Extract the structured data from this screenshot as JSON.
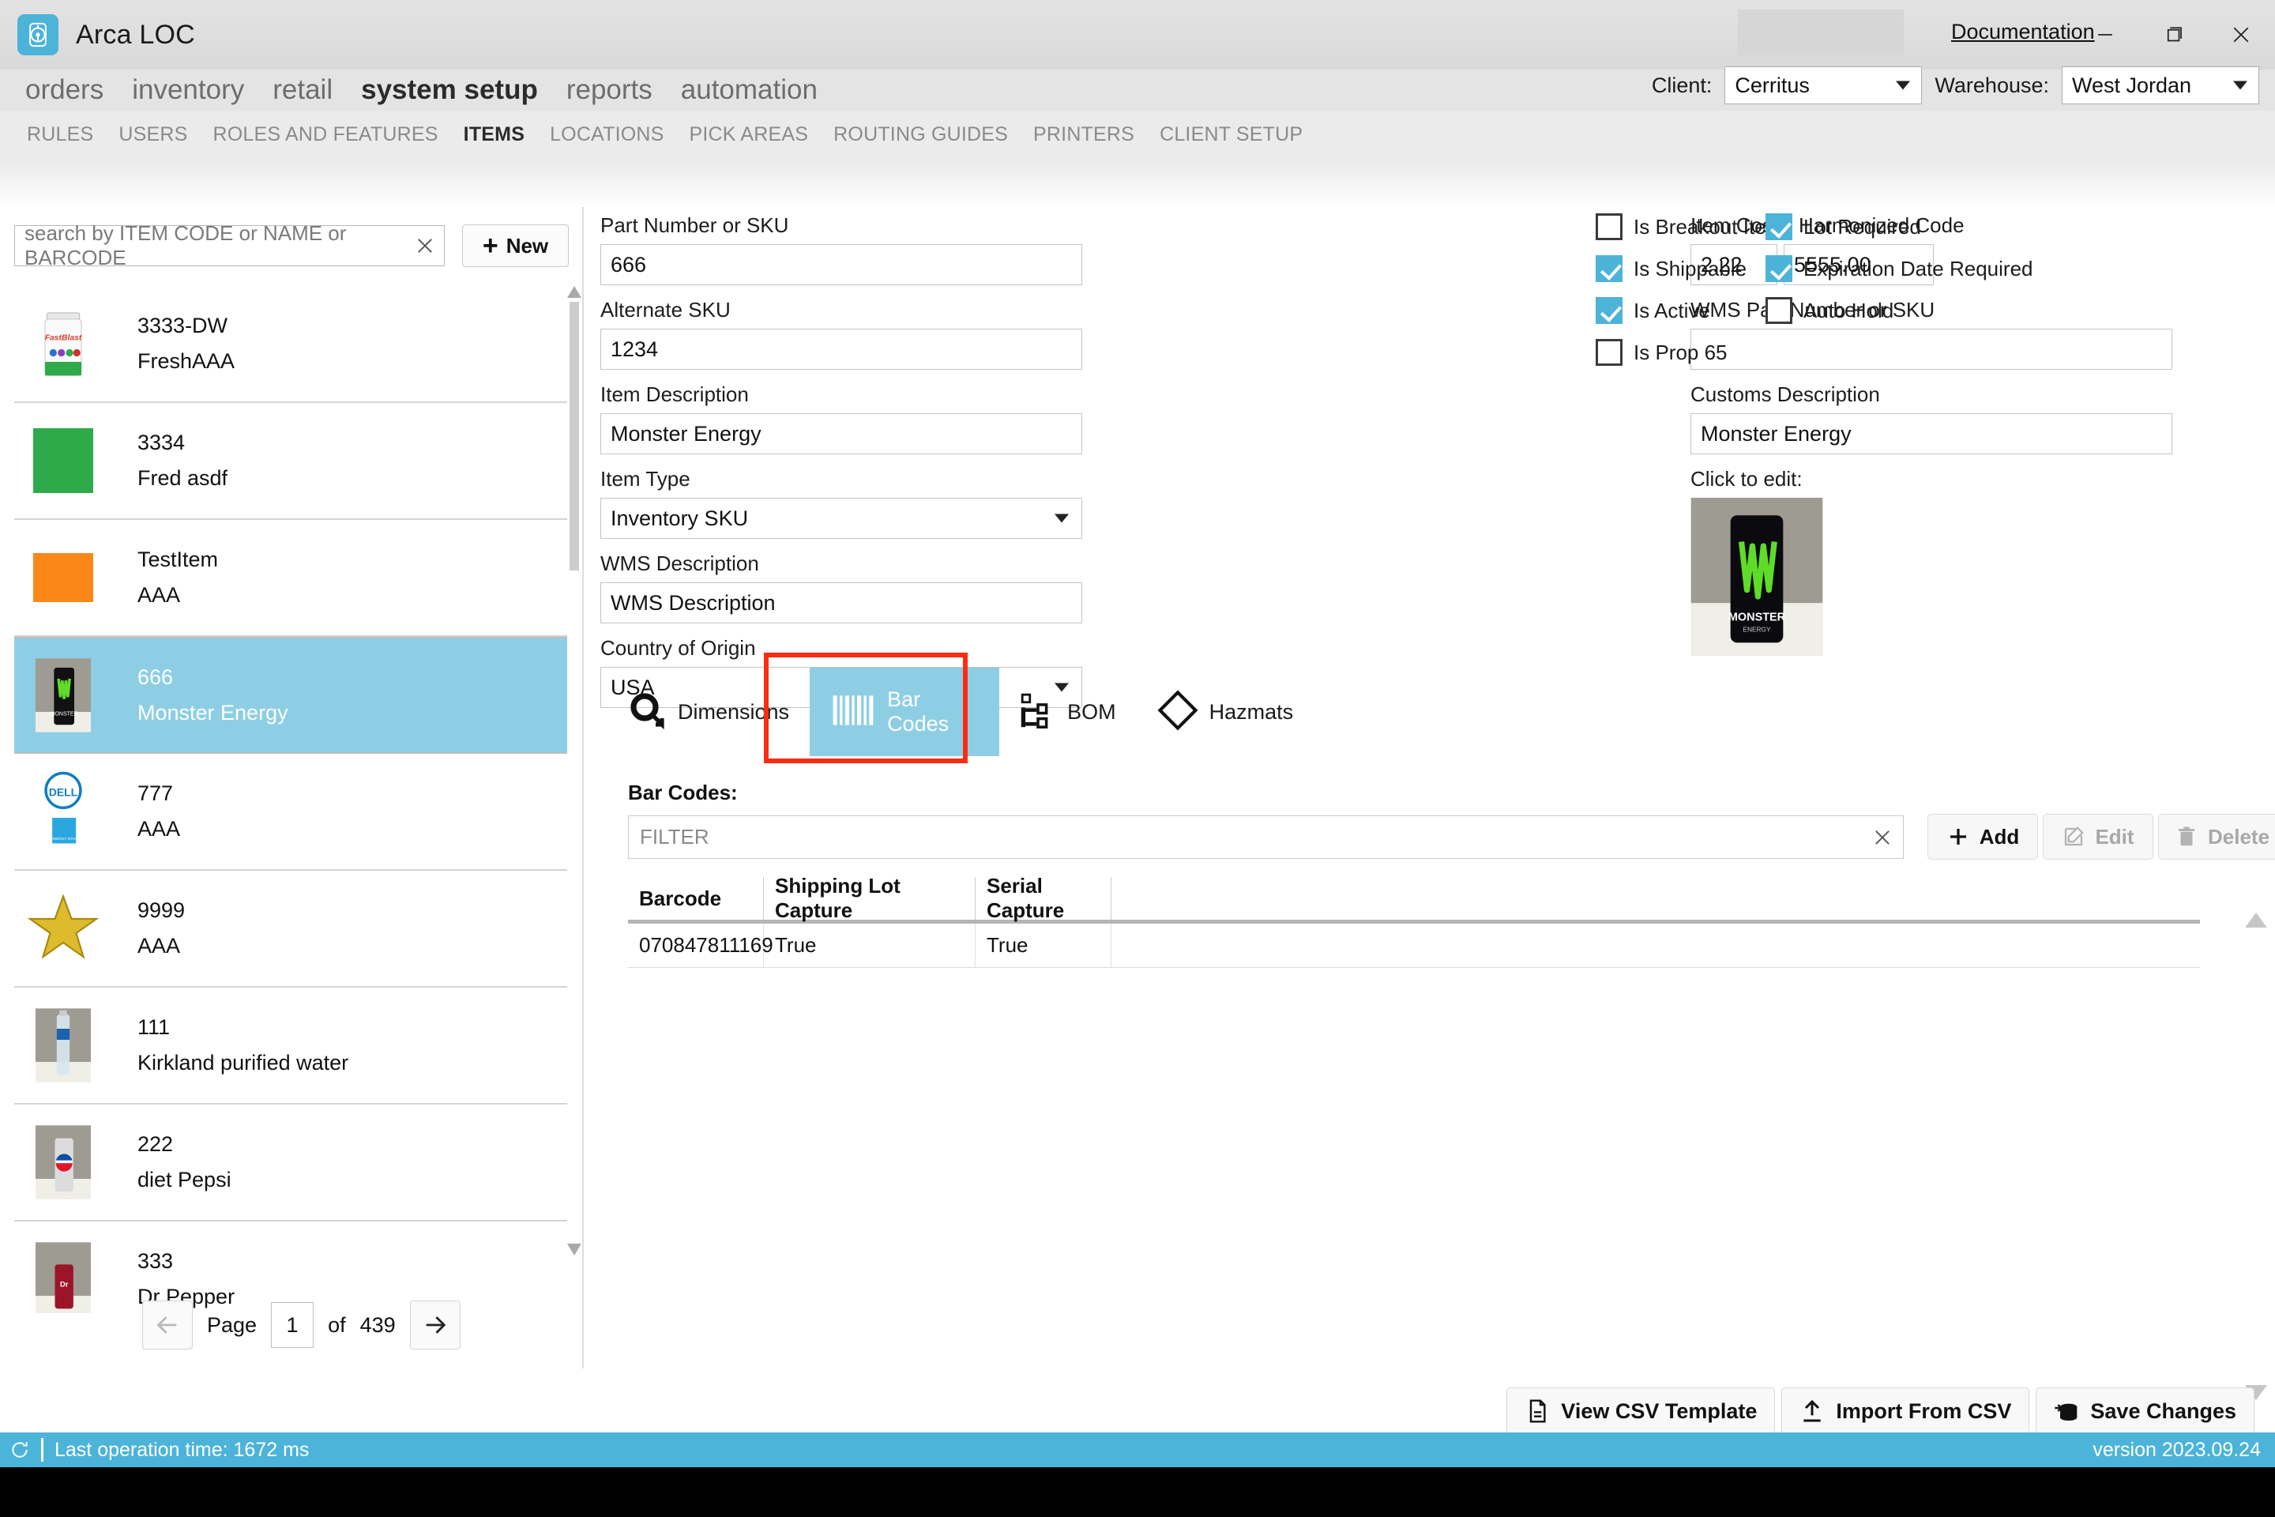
{
  "titlebar": {
    "app_name": "Arca LOC",
    "documentation_link": "Documentation",
    "logo_icon": "compass-icon",
    "minimize_icon": "minimize-icon",
    "restore_icon": "restore-icon",
    "close_icon": "close-icon"
  },
  "mainnav": {
    "items": [
      {
        "label": "orders",
        "active": false
      },
      {
        "label": "inventory",
        "active": false
      },
      {
        "label": "retail",
        "active": false
      },
      {
        "label": "system setup",
        "active": true
      },
      {
        "label": "reports",
        "active": false
      },
      {
        "label": "automation",
        "active": false
      }
    ]
  },
  "selectors": {
    "client_label": "Client:",
    "client_value": "Cerritus",
    "warehouse_label": "Warehouse:",
    "warehouse_value": "West Jordan"
  },
  "subnav": {
    "items": [
      {
        "label": "RULES",
        "active": false
      },
      {
        "label": "USERS",
        "active": false
      },
      {
        "label": "ROLES AND FEATURES",
        "active": false
      },
      {
        "label": "ITEMS",
        "active": true
      },
      {
        "label": "LOCATIONS",
        "active": false
      },
      {
        "label": "PICK AREAS",
        "active": false
      },
      {
        "label": "ROUTING GUIDES",
        "active": false
      },
      {
        "label": "PRINTERS",
        "active": false
      },
      {
        "label": "CLIENT SETUP",
        "active": false
      }
    ]
  },
  "sidebar": {
    "search_placeholder": "search by ITEM CODE or NAME or BARCODE",
    "search_value": "",
    "new_button_label": "New",
    "items": [
      {
        "code": "3333-DW",
        "name": "FreshAAA",
        "thumb": "supplement-jar",
        "selected": false
      },
      {
        "code": "3334",
        "name": "Fred asdf",
        "thumb": "green-swatch",
        "selected": false
      },
      {
        "code": "TestItem",
        "name": "AAA",
        "thumb": "orange-swatch",
        "selected": false
      },
      {
        "code": "666",
        "name": "Monster Energy",
        "thumb": "monster-can",
        "selected": true
      },
      {
        "code": "777",
        "name": "AAA",
        "thumb": "dell-logo",
        "selected": false
      },
      {
        "code": "9999",
        "name": "AAA",
        "thumb": "gold-star",
        "selected": false
      },
      {
        "code": "111",
        "name": "Kirkland purified water",
        "thumb": "water-bottle",
        "selected": false
      },
      {
        "code": "222",
        "name": "diet Pepsi",
        "thumb": "pepsi-can",
        "selected": false
      },
      {
        "code": "333",
        "name": "Dr Pepper",
        "thumb": "drpepper-can",
        "selected": false
      }
    ],
    "pager": {
      "prev_icon": "arrow-left-icon",
      "page_label": "Page",
      "page_value": "1",
      "of_label": "of",
      "total_pages": "439",
      "next_icon": "arrow-right-icon"
    }
  },
  "form": {
    "part_number_label": "Part Number or SKU",
    "part_number_value": "666",
    "alternate_sku_label": "Alternate SKU",
    "alternate_sku_value": "1234",
    "item_description_label": "Item Description",
    "item_description_value": "Monster Energy",
    "item_type_label": "Item Type",
    "item_type_value": "Inventory SKU",
    "wms_description_label": "WMS Description",
    "wms_description_value": "WMS Description",
    "country_label": "Country of Origin",
    "country_value": "USA",
    "item_cost_label": "Item Cost",
    "item_cost_value": "2.22",
    "harmonized_label": "Harmonized Code",
    "harmonized_value": "5555.00",
    "wms_part_label": "WMS Part Number or SKU",
    "wms_part_value": "",
    "customs_description_label": "Customs Description",
    "customs_description_value": "Monster Energy",
    "click_to_edit_label": "Click to edit:",
    "image_alt": "monster-can-photo"
  },
  "checkboxes": [
    {
      "label": "Is Breakout Item",
      "checked": false
    },
    {
      "label": "Lot Required",
      "checked": true
    },
    {
      "label": "Is Shippable",
      "checked": true
    },
    {
      "label": "Expiration Date Required",
      "checked": true
    },
    {
      "label": "Is Active",
      "checked": true
    },
    {
      "label": "Auto Hold",
      "checked": false
    },
    {
      "label": "Is Prop 65",
      "checked": false
    }
  ],
  "tabs": [
    {
      "label": "Dimensions",
      "icon": "dimensions-icon",
      "selected": false
    },
    {
      "label": "Bar Codes",
      "icon": "barcode-icon",
      "selected": true
    },
    {
      "label": "BOM",
      "icon": "bom-tree-icon",
      "selected": false
    },
    {
      "label": "Hazmats",
      "icon": "hazmat-diamond-icon",
      "selected": false
    }
  ],
  "barcodes": {
    "section_label": "Bar Codes:",
    "filter_placeholder": "FILTER",
    "filter_value": "",
    "add_label": "Add",
    "edit_label": "Edit",
    "delete_label": "Delete",
    "columns": [
      "Barcode",
      "Shipping Lot Capture",
      "Serial Capture",
      ""
    ],
    "rows": [
      {
        "barcode": "070847811169",
        "shipping_lot_capture": "True",
        "serial_capture": "True",
        "extra": ""
      }
    ]
  },
  "bottombar": {
    "view_csv_label": "View CSV Template",
    "import_csv_label": "Import From CSV",
    "save_changes_label": "Save Changes"
  },
  "statusbar": {
    "refresh_icon": "refresh-icon",
    "status_text": "Last operation time:  1672 ms",
    "version_text": "version 2023.09.24"
  },
  "colors": {
    "accent": "#4cb3d9",
    "selection": "#8ecee4",
    "highlight": "#fc2c14"
  }
}
